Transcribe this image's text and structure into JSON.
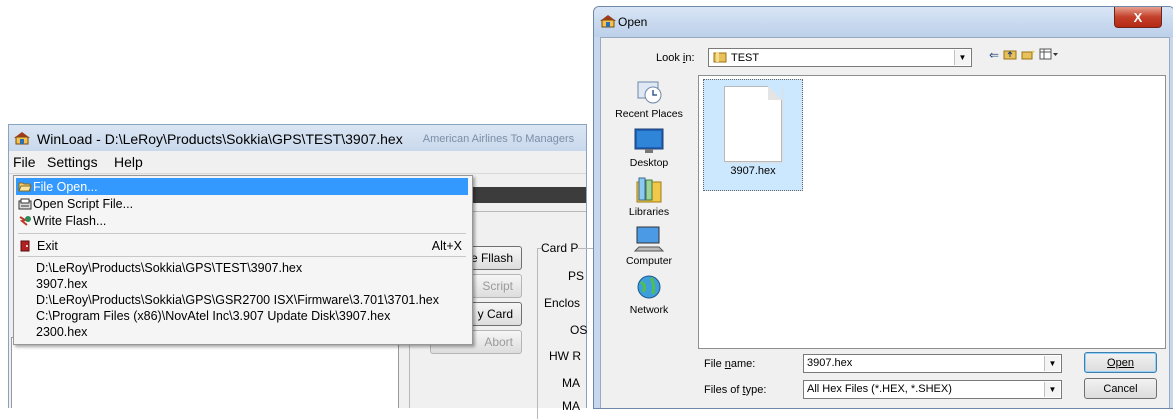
{
  "winload": {
    "title": "WinLoad - D:\\LeRoy\\Products\\Sokkia\\GPS\\TEST\\3907.hex",
    "background_tabs_text": "American Airlines  To Managers",
    "menubar": [
      "File",
      "Settings",
      "Help"
    ],
    "file_menu": {
      "items": [
        {
          "label": "File Open...",
          "icon": "folder-open-icon",
          "highlighted": true
        },
        {
          "label": "Open Script File...",
          "icon": "script-icon"
        },
        {
          "label": "Write Flash...",
          "icon": "flash-icon"
        }
      ],
      "exit": {
        "label": "Exit",
        "shortcut": "Alt+X",
        "icon": "exit-icon"
      },
      "recent_files": [
        "D:\\LeRoy\\Products\\Sokkia\\GPS\\TEST\\3907.hex",
        "3907.hex",
        "D:\\LeRoy\\Products\\Sokkia\\GPS\\GSR2700 ISX\\Firmware\\3.701\\3701.hex",
        "C:\\Program Files (x86)\\NovAtel Inc\\3.907 Update Disk\\3907.hex",
        "2300.hex"
      ]
    },
    "buttons": {
      "write_flash": "e Fllash",
      "script": "Script",
      "copy_card": "y Card",
      "abort": "Abort"
    },
    "card_labels": {
      "group": "Card P",
      "ps": "PS",
      "enclosure": "Enclos",
      "os": "OS",
      "hw": "HW R",
      "ma1": "MA",
      "ma2": "MA"
    }
  },
  "open_dialog": {
    "title": "Open",
    "close_label": "X",
    "look_in_label": "Look in:",
    "look_in_value": "TEST",
    "places": [
      "Recent Places",
      "Desktop",
      "Libraries",
      "Computer",
      "Network"
    ],
    "files": [
      "3907.hex"
    ],
    "file_name_label": "File name:",
    "file_name_value": "3907.hex",
    "file_type_label": "Files of type:",
    "file_type_value": "All Hex Files (*.HEX, *.SHEX)",
    "open_button": "Open",
    "cancel_button": "Cancel"
  }
}
